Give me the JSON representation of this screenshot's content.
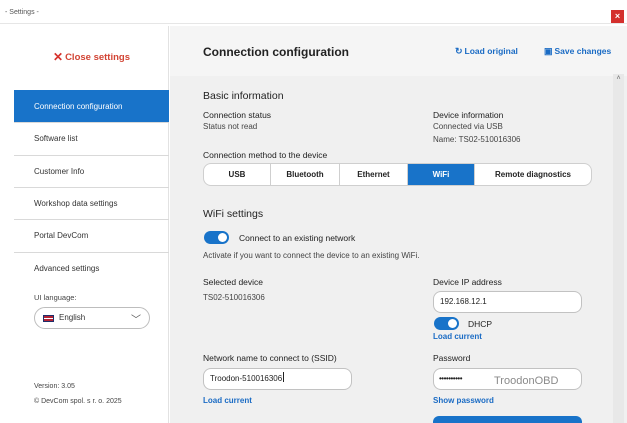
{
  "window": {
    "title": "- Settings -",
    "close_glyph": "×"
  },
  "sidebar": {
    "close_settings": {
      "icon": "close-icon",
      "label": "Close settings"
    },
    "items": [
      {
        "label": "Connection configuration",
        "active": true
      },
      {
        "label": "Software list"
      },
      {
        "label": "Customer Info"
      },
      {
        "label": "Workshop data settings"
      },
      {
        "label": "Portal DevCom"
      },
      {
        "label": "Advanced settings"
      }
    ],
    "language": {
      "label": "UI language:",
      "value": "English",
      "flag_icon": "uk-flag-icon"
    },
    "version": "Version: 3.05",
    "copyright": "© DevCom spol. s r. o. 2025"
  },
  "header": {
    "title": "Connection configuration",
    "load_original": "Load original",
    "save_changes": "Save changes"
  },
  "basic": {
    "title": "Basic information",
    "status_label": "Connection status",
    "status_value": "Status not read",
    "device_label": "Device information",
    "device_conn": "Connected via USB",
    "device_name": "Name: TS02-510016306"
  },
  "method": {
    "label": "Connection method to the device",
    "options": [
      "USB",
      "Bluetooth",
      "Ethernet",
      "WiFi",
      "Remote diagnostics"
    ],
    "selected": "WiFi"
  },
  "wifi": {
    "title": "WiFi settings",
    "connect_existing": "Connect to an existing network",
    "hint": "Activate if you want to connect the device to an existing WiFi.",
    "selected_device_label": "Selected device",
    "selected_device_value": "TS02-510016306",
    "ip_label": "Device IP address",
    "ip_value": "192.168.12.1",
    "dhcp_label": "DHCP",
    "load_current": "Load current",
    "ssid_label": "Network name to connect to (SSID)",
    "ssid_value": "Troodon-510016306",
    "password_label": "Password",
    "password_dots": "••••••••••",
    "password_watermark": "TroodonOBD",
    "show_password": "Show password"
  },
  "colors": {
    "accent": "#1873c9",
    "close_red": "#d6312b",
    "link": "#1a6bc4"
  }
}
